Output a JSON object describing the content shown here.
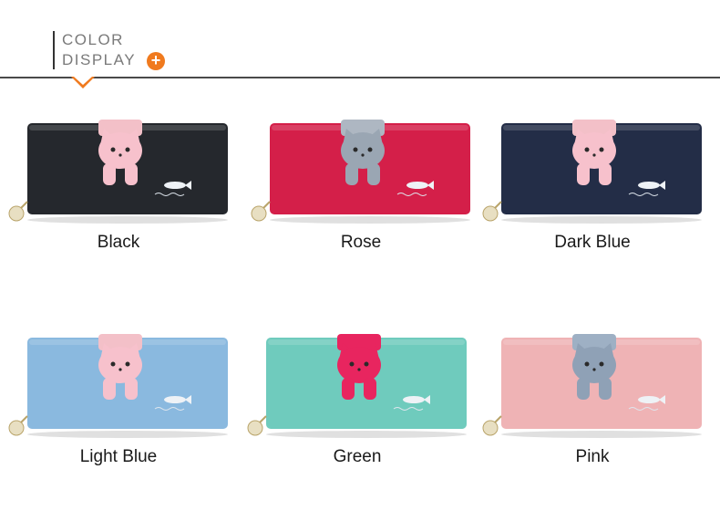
{
  "header": {
    "title_line1": "COLOR",
    "title_line2": "DISPLAY",
    "accent": "#f07a1e"
  },
  "products": [
    {
      "label": "Black",
      "body": "#25282d",
      "cat": "#f7c1cc",
      "strap": "#f3c0c8"
    },
    {
      "label": "Rose",
      "body": "#d41f49",
      "cat": "#9aa6b3",
      "strap": "#aeb7c2"
    },
    {
      "label": "Dark Blue",
      "body": "#232d47",
      "cat": "#f7c1cc",
      "strap": "#f3c0c8"
    },
    {
      "label": "Light Blue",
      "body": "#8ab9df",
      "cat": "#f7c1cc",
      "strap": "#f3c0c8"
    },
    {
      "label": "Green",
      "body": "#6fcbbd",
      "cat": "#e8255f",
      "strap": "#e8255f"
    },
    {
      "label": "Pink",
      "body": "#efb3b5",
      "cat": "#8fa1b6",
      "strap": "#9eb0c4"
    }
  ]
}
